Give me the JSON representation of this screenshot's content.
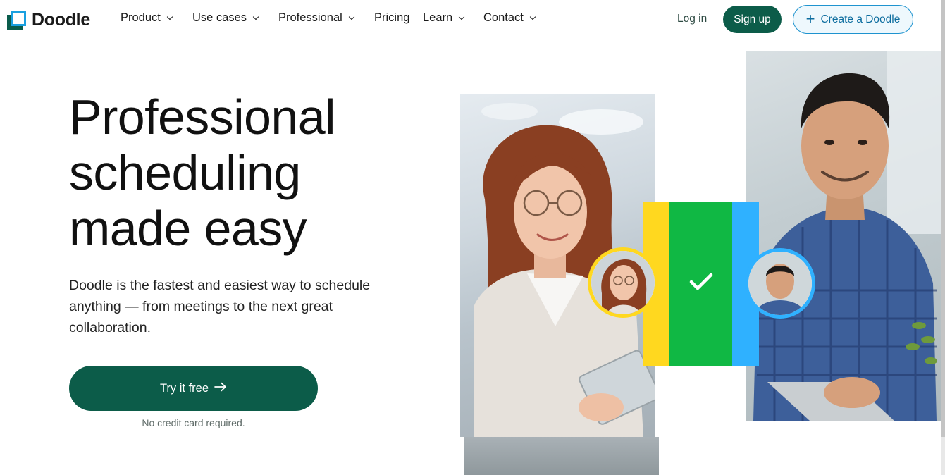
{
  "brand": {
    "name": "Doodle"
  },
  "nav": {
    "items": [
      {
        "label": "Product",
        "has_dropdown": true
      },
      {
        "label": "Use cases",
        "has_dropdown": true
      },
      {
        "label": "Professional",
        "has_dropdown": true
      },
      {
        "label": "Pricing",
        "has_dropdown": false
      },
      {
        "label": "Learn",
        "has_dropdown": true
      },
      {
        "label": "Contact",
        "has_dropdown": true
      }
    ],
    "login_label": "Log in",
    "signup_label": "Sign up",
    "create_label": "Create a Doodle"
  },
  "hero": {
    "title_lines": [
      "Professional",
      "scheduling",
      "made easy"
    ],
    "subtitle": "Doodle is the fastest and easiest way to schedule anything — from meetings to the next great collaboration.",
    "cta_label": "Try it free",
    "note": "No credit card required."
  },
  "colors": {
    "brand_green": "#0c5c49",
    "accent_blue": "#1e93cf",
    "bar_yellow": "#ffd81f",
    "bar_green": "#10b844",
    "bar_blue": "#2fb1ff"
  },
  "icons": {
    "chevron": "chevron-down-icon",
    "plus": "plus-icon",
    "arrow": "arrow-right-icon",
    "check": "check-icon"
  }
}
